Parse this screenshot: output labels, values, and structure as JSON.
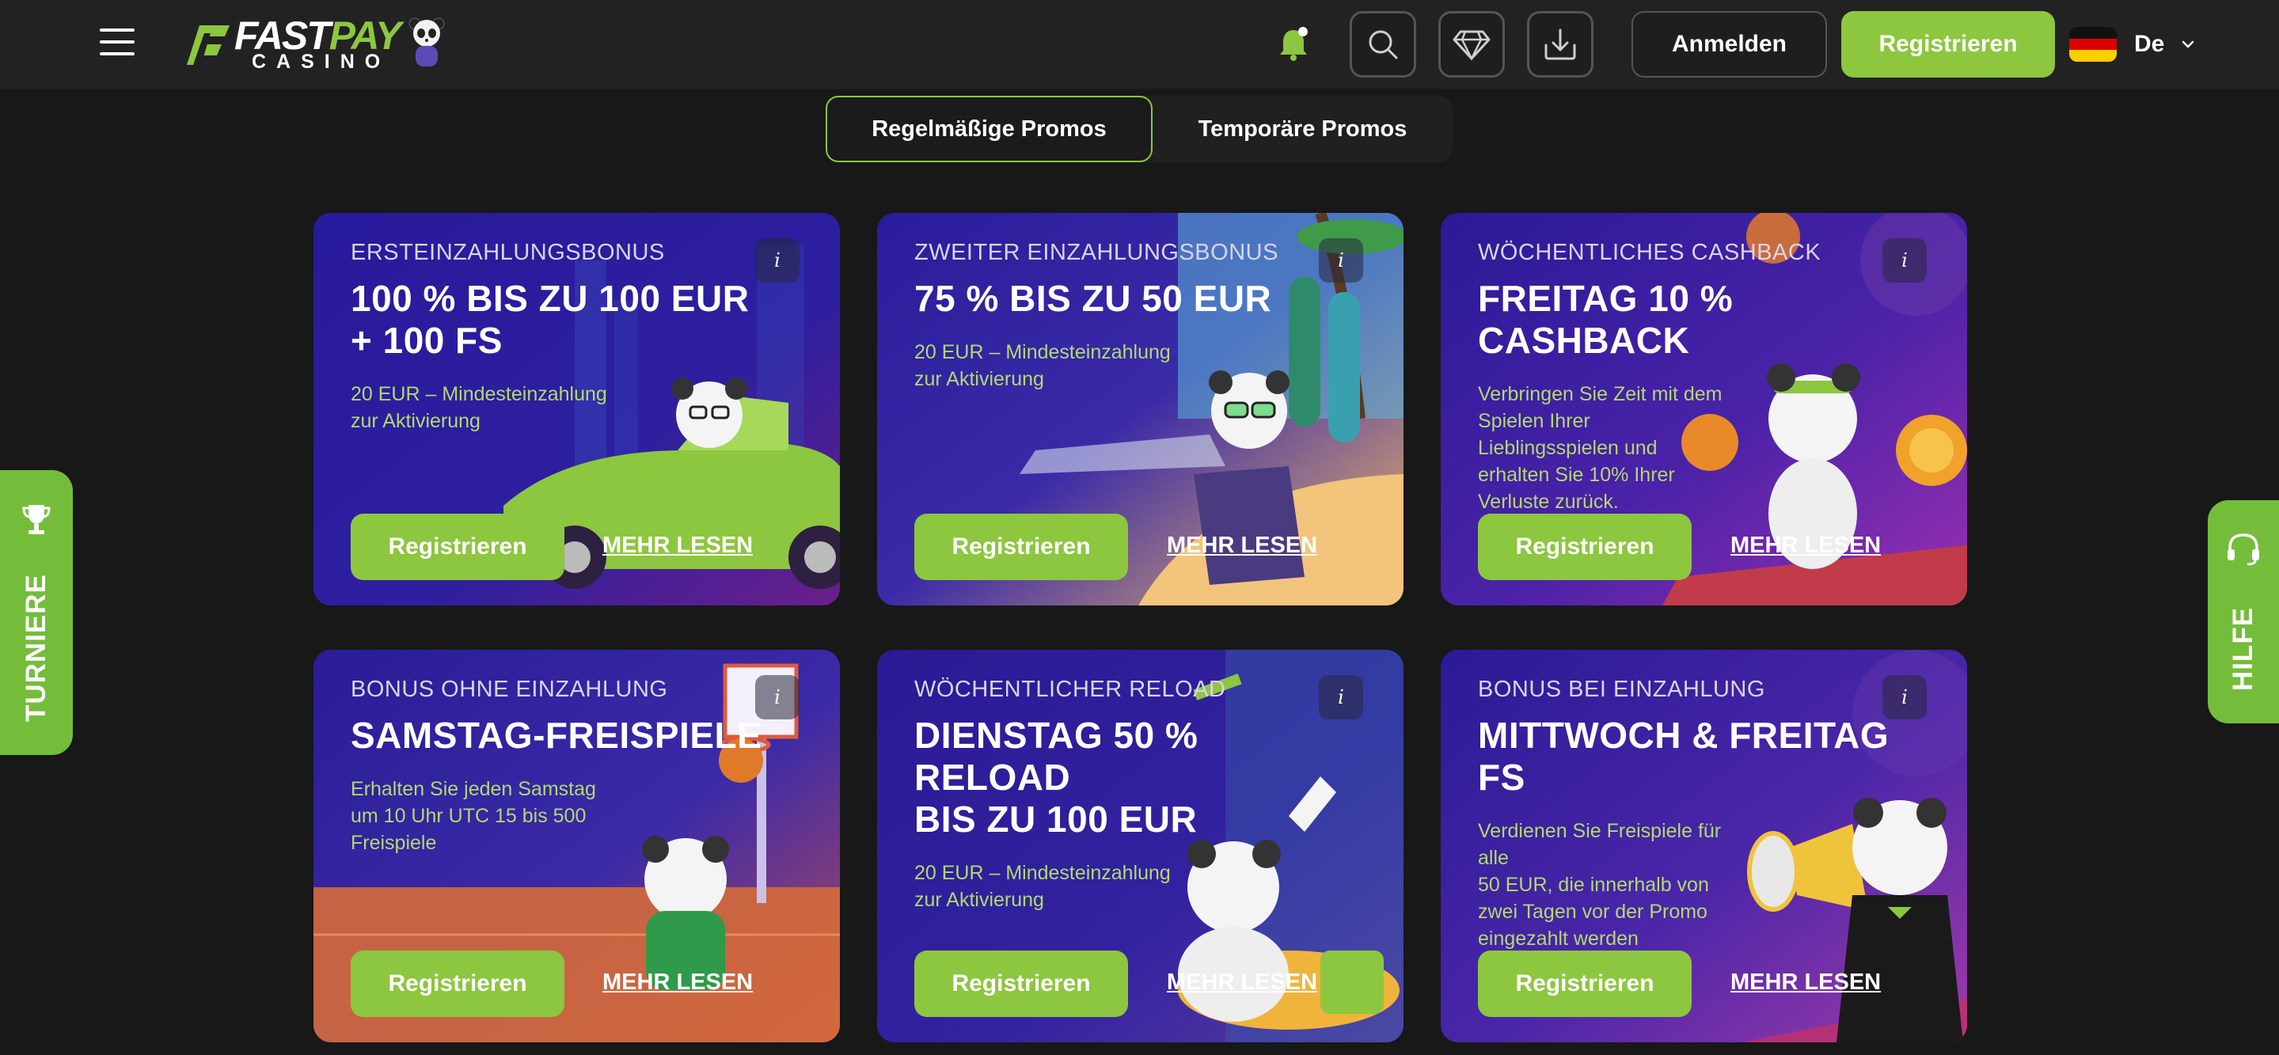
{
  "header": {
    "logo": {
      "brand_fast": "FAST",
      "brand_pay": "PAY",
      "brand_sub": "CASINO"
    },
    "login_label": "Anmelden",
    "register_label": "Registrieren",
    "language": "De",
    "icons": [
      "menu-icon",
      "bell-icon",
      "search-icon",
      "diamond-icon",
      "download-icon",
      "chevron-down-icon"
    ]
  },
  "tabs": [
    {
      "label": "Regelmäßige Promos",
      "active": true
    },
    {
      "label": "Temporäre Promos",
      "active": false
    }
  ],
  "cards": [
    {
      "eyebrow": "ERSTEINZAHLUNGSBONUS",
      "title": "100 % BIS ZU 100 EUR\n+ 100 FS",
      "desc": "20 EUR – Mindesteinzahlung\nzur Aktivierung",
      "register": "Registrieren",
      "more": "MEHR LESEN",
      "info": "i"
    },
    {
      "eyebrow": "ZWEITER EINZAHLUNGSBONUS",
      "title": "75 % BIS ZU 50 EUR",
      "desc": "20 EUR – Mindesteinzahlung\nzur Aktivierung",
      "register": "Registrieren",
      "more": "MEHR LESEN",
      "info": "i"
    },
    {
      "eyebrow": "WÖCHENTLICHES CASHBACK",
      "title": "FREITAG 10 %\nCASHBACK",
      "desc": "Verbringen Sie Zeit mit dem\nSpielen Ihrer\nLieblingsspielen und\nerhalten Sie 10% Ihrer\nVerluste zurück.",
      "register": "Registrieren",
      "more": "MEHR LESEN",
      "info": "i"
    },
    {
      "eyebrow": "BONUS OHNE EINZAHLUNG",
      "title": "SAMSTAG-FREISPIELE",
      "desc": "Erhalten Sie jeden Samstag\num 10 Uhr UTC 15 bis 500\nFreispiele",
      "register": "Registrieren",
      "more": "MEHR LESEN",
      "info": "i"
    },
    {
      "eyebrow": "WÖCHENTLICHER RELOAD",
      "title": "DIENSTAG 50 %\nRELOAD\nBIS ZU 100 EUR",
      "desc": "20 EUR – Mindesteinzahlung\nzur Aktivierung",
      "register": "Registrieren",
      "more": "MEHR LESEN",
      "info": "i"
    },
    {
      "eyebrow": "BONUS BEI EINZAHLUNG",
      "title": "MITTWOCH & FREITAG\nFS",
      "desc": "Verdienen Sie Freispiele für\nalle\n50 EUR, die innerhalb von\nzwei Tagen vor der Promo\neingezahlt werden",
      "register": "Registrieren",
      "more": "MEHR LESEN",
      "info": "i"
    }
  ],
  "side": {
    "left_label": "TURNIERE",
    "right_label": "HILFE"
  },
  "colors": {
    "accent": "#8dc63f",
    "side_tab": "#74bd3a",
    "background": "#181818",
    "header": "#222222"
  }
}
